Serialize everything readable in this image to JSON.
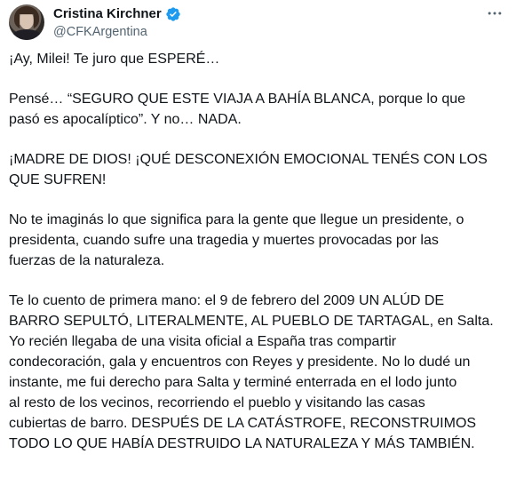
{
  "author": {
    "display_name": "Cristina Kirchner",
    "handle": "@CFKArgentina",
    "verified_icon": "verified-badge-icon",
    "verified_color": "#1d9bf0"
  },
  "more_icon": "more-horizontal-icon",
  "tweet": {
    "paragraphs": [
      "¡Ay, Milei! Te juro que ESPERÉ…",
      "Pensé… “SEGURO QUE ESTE VIAJA A BAHÍA BLANCA, porque lo que\npasó es apocalíptico”. Y no… NADA.",
      "¡MADRE DE DIOS! ¡QUÉ DESCONEXIÓN EMOCIONAL TENÉS CON LOS\nQUE SUFREN!",
      "No te imaginás lo que significa para la gente que llegue un presidente, o\npresidenta, cuando sufre una tragedia y muertes provocadas por las\nfuerzas de la naturaleza.",
      "Te lo cuento de primera mano: el 9 de febrero del 2009 UN ALÚD DE\nBARRO SEPULTÓ, LITERALMENTE, AL PUEBLO DE TARTAGAL, en Salta.\nYo recién llegaba de una visita oficial a España tras compartir\ncondecoración, gala y encuentros con Reyes y presidente. No lo dudé un\ninstante, me fui derecho para Salta y terminé enterrada en el lodo junto\nal resto de los vecinos, recorriendo el pueblo y visitando las casas\ncubiertas de barro. DESPUÉS DE LA CATÁSTROFE, RECONSTRUIMOS\nTODO LO QUE HABÍA DESTRUIDO LA NATURALEZA Y MÁS TAMBIÉN."
    ]
  }
}
